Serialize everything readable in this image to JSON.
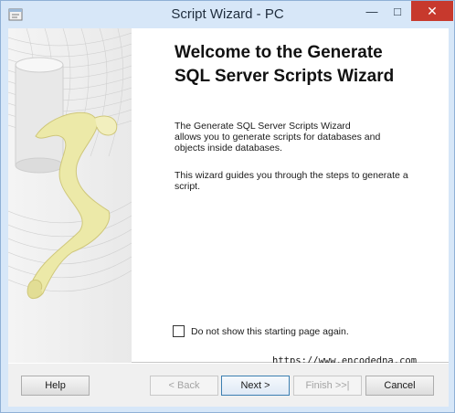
{
  "window": {
    "title": "Script Wizard - PC"
  },
  "titlebar": {
    "minimize_icon": "minimize-icon",
    "maximize_icon": "maximize-icon",
    "close_icon": "close-icon",
    "minimize_glyph": "—",
    "maximize_glyph": "□",
    "close_glyph": "✕"
  },
  "page": {
    "heading_line1": "Welcome to the Generate",
    "heading_line2": "SQL Server Scripts Wizard",
    "para1": "The Generate SQL Server Scripts Wizard\nallows you to generate scripts for databases and\nobjects inside databases.",
    "para2": "This wizard guides you through the steps to generate a\nscript.",
    "checkbox_label": "Do not show this starting page again.",
    "checkbox_checked": false
  },
  "watermark": "https://www.encodedna.com",
  "footer": {
    "help": "Help",
    "back": "< Back",
    "next": "Next >",
    "finish": "Finish >>|",
    "cancel": "Cancel"
  },
  "colors": {
    "titlebar": "#d7e7f8",
    "close_button": "#c7392d",
    "scroll_art": "#ece9a8"
  }
}
